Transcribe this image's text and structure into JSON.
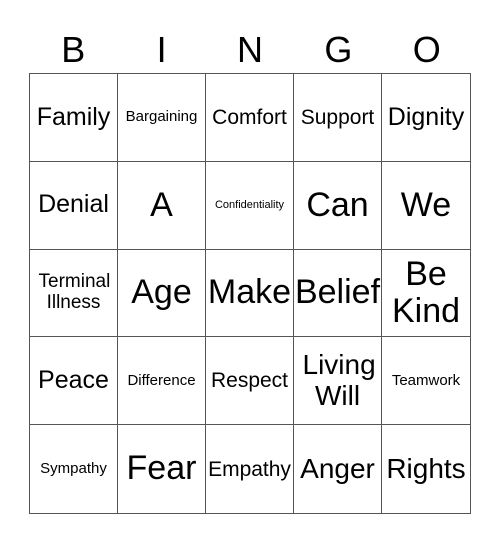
{
  "header": [
    "B",
    "I",
    "N",
    "G",
    "O"
  ],
  "cells": [
    {
      "text": "Family",
      "size": "xl"
    },
    {
      "text": "Bargaining",
      "size": "s"
    },
    {
      "text": "Comfort",
      "size": "l"
    },
    {
      "text": "Support",
      "size": "l"
    },
    {
      "text": "Dignity",
      "size": "xl"
    },
    {
      "text": "Denial",
      "size": "xl"
    },
    {
      "text": "A",
      "size": "xxl"
    },
    {
      "text": "Confidentiality",
      "size": "xs"
    },
    {
      "text": "Can",
      "size": "xxl"
    },
    {
      "text": "We",
      "size": "xxl"
    },
    {
      "text": "Terminal Illness",
      "size": "m"
    },
    {
      "text": "Age",
      "size": "xxl"
    },
    {
      "text": "Make",
      "size": "xxl"
    },
    {
      "text": "Belief",
      "size": "xxl"
    },
    {
      "text": "Be Kind",
      "size": "xxl"
    },
    {
      "text": "Peace",
      "size": "xl"
    },
    {
      "text": "Difference",
      "size": "s"
    },
    {
      "text": "Respect",
      "size": "l"
    },
    {
      "text": "Living Will",
      "size": "xl2"
    },
    {
      "text": "Teamwork",
      "size": "s"
    },
    {
      "text": "Sympathy",
      "size": "s"
    },
    {
      "text": "Fear",
      "size": "xxl"
    },
    {
      "text": "Empathy",
      "size": "l"
    },
    {
      "text": "Anger",
      "size": "xl2"
    },
    {
      "text": "Rights",
      "size": "xl2"
    }
  ]
}
